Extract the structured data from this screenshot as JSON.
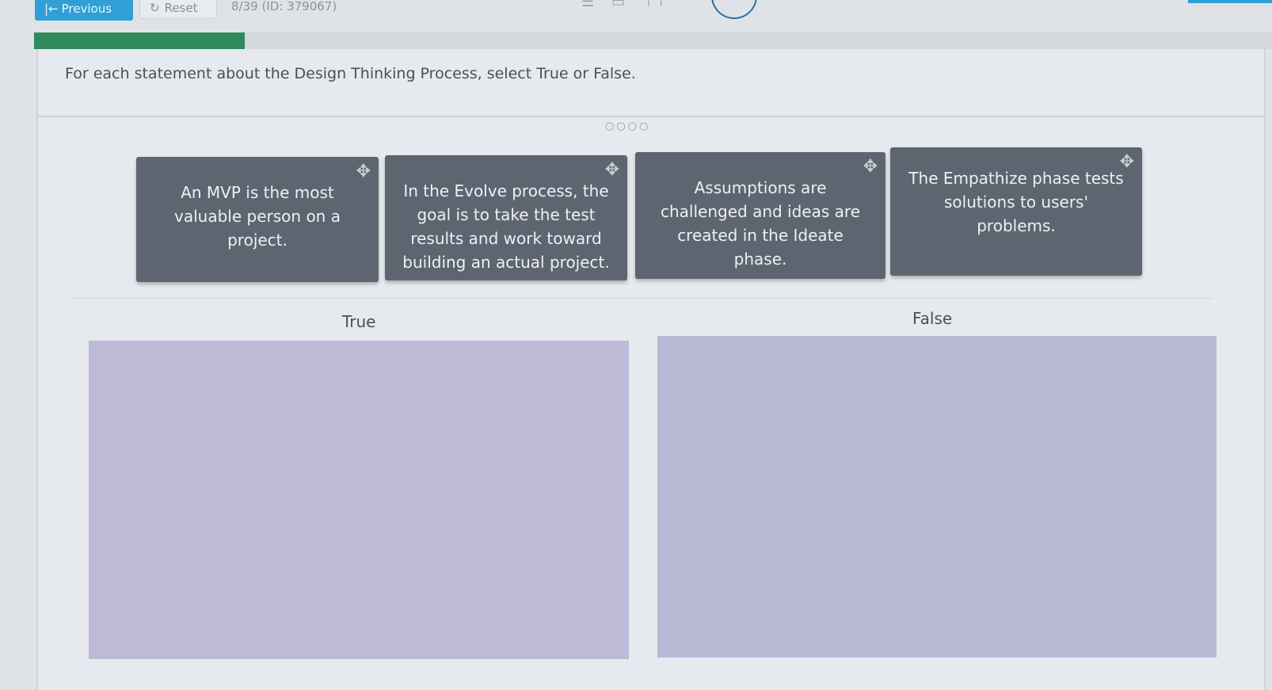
{
  "toolbar": {
    "previous_label": "Previous",
    "previous_icon": "first-page-arrow-icon",
    "reset_label": "Reset",
    "reset_icon": "refresh-icon",
    "counter": "8/39 (ID: 379067)"
  },
  "progress": {
    "fraction": 0.17
  },
  "instruction": "For each statement about the Design Thinking Process, select True or False.",
  "statements": [
    {
      "text": "An MVP is the most valuable person on a project."
    },
    {
      "text": "In the Evolve process, the goal is to take the test results and work toward building an actual project."
    },
    {
      "text": "Assumptions are challenged and ideas are created in the Ideate phase."
    },
    {
      "text": "The Empathize phase tests solutions to users' problems."
    }
  ],
  "zones": {
    "true_label": "True",
    "false_label": "False"
  },
  "colors": {
    "accent": "#2f9fd6",
    "progress": "#2f8a5c",
    "tile": "#5d6571",
    "dropzone": "#bdb9d6"
  }
}
